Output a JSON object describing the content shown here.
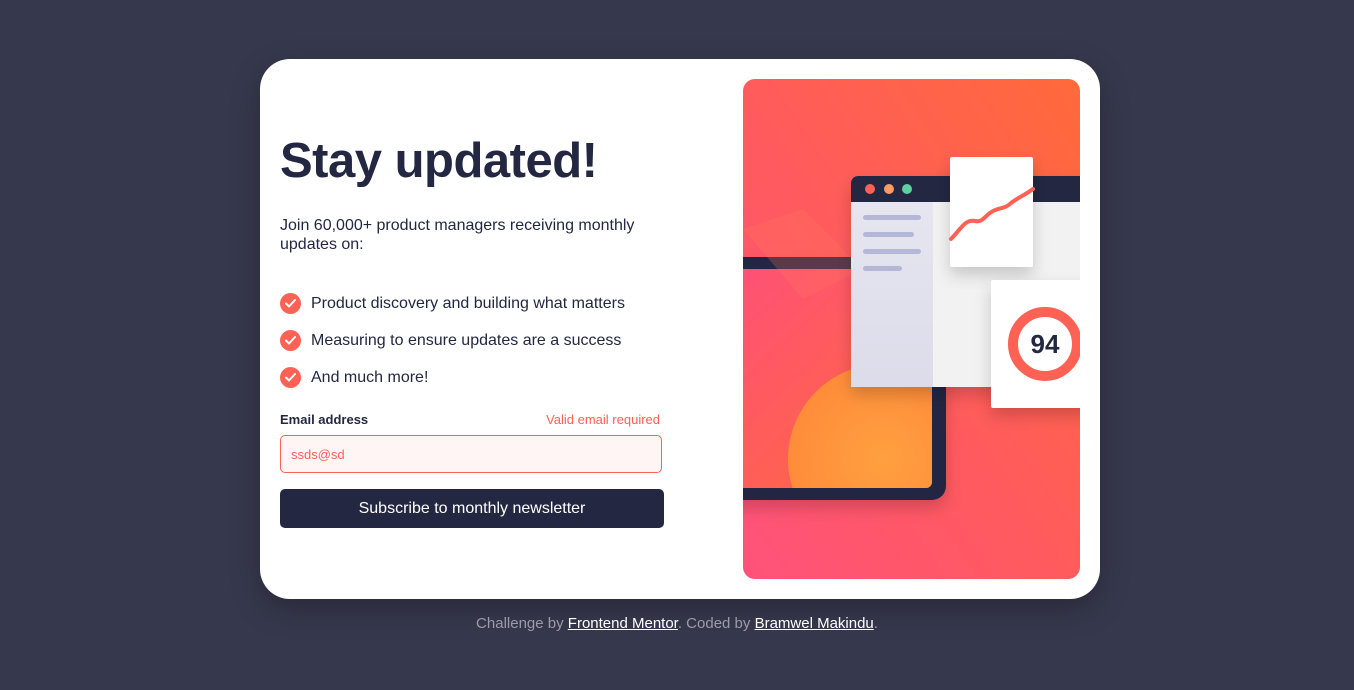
{
  "card": {
    "title": "Stay updated!",
    "intro": "Join 60,000+ product managers receiving monthly updates on:",
    "features": [
      "Product discovery and building what matters",
      "Measuring to ensure updates are a success",
      "And much more!"
    ],
    "form": {
      "email_label": "Email address",
      "error_message": "Valid email required",
      "email_value": "ssds@sd",
      "submit_label": "Subscribe to monthly newsletter"
    },
    "illustration": {
      "score": "94"
    }
  },
  "footer": {
    "prefix": "Challenge by ",
    "link1": "Frontend Mentor",
    "middle": ". Coded by ",
    "link2": "Bramwel Makindu",
    "suffix": "."
  },
  "colors": {
    "background": "#36384d",
    "navy": "#242742",
    "tomato": "#ff6155",
    "white": "#ffffff"
  },
  "icons": [
    "check-icon"
  ]
}
